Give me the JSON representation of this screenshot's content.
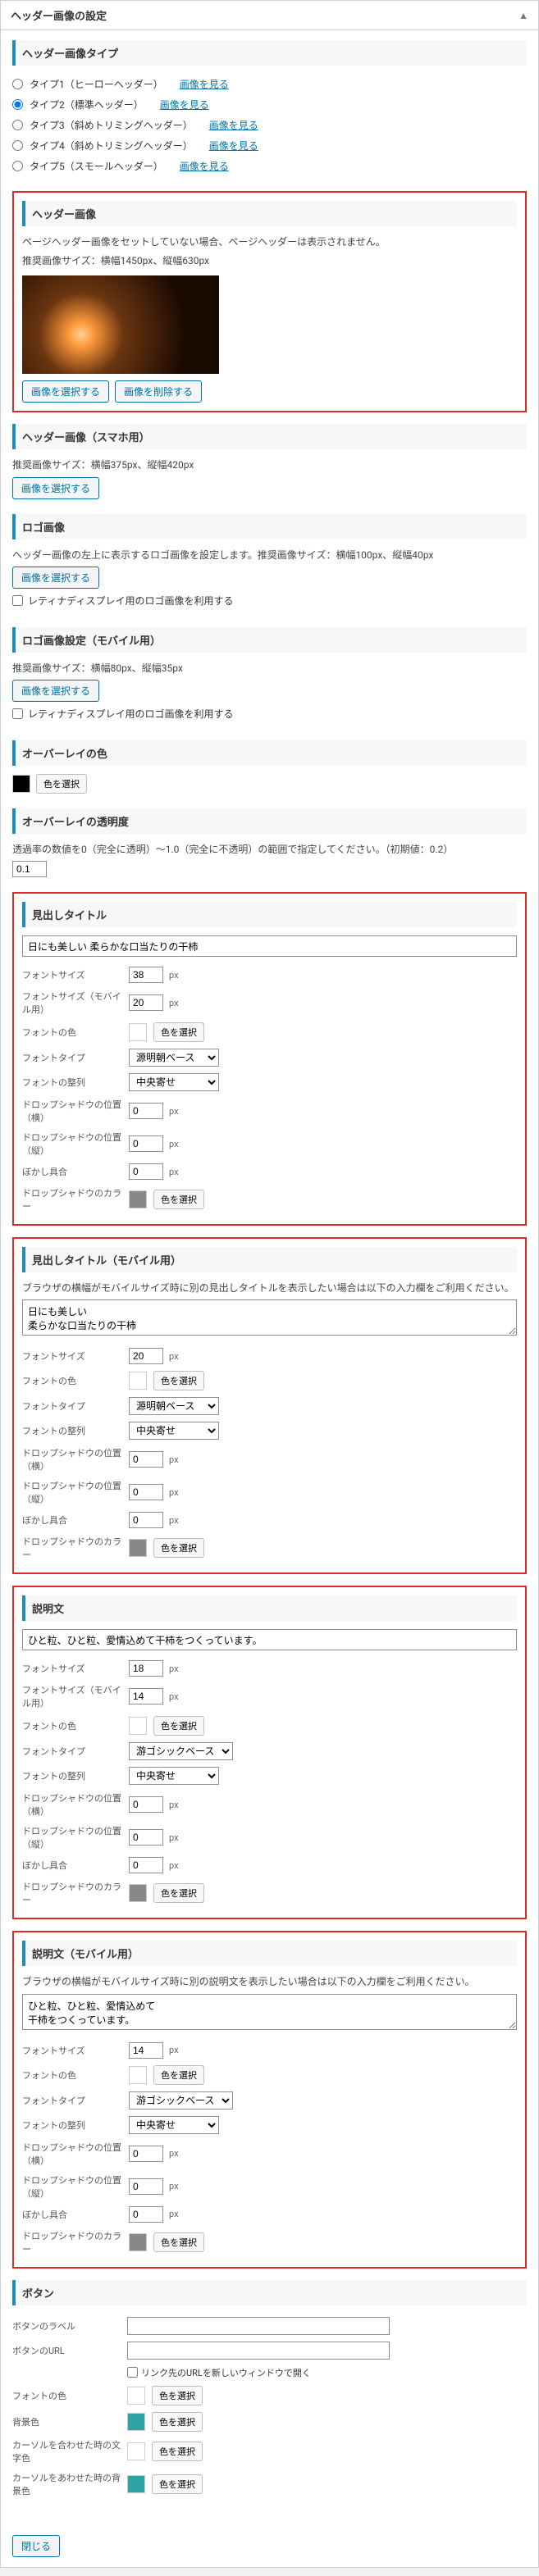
{
  "panel": {
    "title": "ヘッダー画像の設定",
    "toggle": "▲"
  },
  "headerType": {
    "heading": "ヘッダー画像タイプ",
    "view": "画像を見る",
    "opts": [
      "タイプ1（ヒーローヘッダー）",
      "タイプ2（標準ヘッダー）",
      "タイプ3（斜めトリミングヘッダー）",
      "タイプ4（斜めトリミングヘッダー）",
      "タイプ5（スモールヘッダー）"
    ]
  },
  "headerImage": {
    "heading": "ヘッダー画像",
    "note1": "ページヘッダー画像をセットしていない場合、ページヘッダーは表示されません。",
    "note2": "推奨画像サイズ：横幅1450px、縦幅630px",
    "select": "画像を選択する",
    "remove": "画像を削除する"
  },
  "headerImageSp": {
    "heading": "ヘッダー画像（スマホ用）",
    "note": "推奨画像サイズ：横幅375px、縦幅420px",
    "select": "画像を選択する"
  },
  "logo": {
    "heading": "ロゴ画像",
    "note": "ヘッダー画像の左上に表示するロゴ画像を設定します。推奨画像サイズ：横幅100px、縦幅40px",
    "select": "画像を選択する",
    "retina": "レティナディスプレイ用のロゴ画像を利用する"
  },
  "logoSp": {
    "heading": "ロゴ画像設定（モバイル用）",
    "note": "推奨画像サイズ：横幅80px、縦幅35px",
    "select": "画像を選択する",
    "retina": "レティナディスプレイ用のロゴ画像を利用する"
  },
  "overlayColor": {
    "heading": "オーバーレイの色",
    "btn": "色を選択"
  },
  "overlayOpacity": {
    "heading": "オーバーレイの透明度",
    "note": "透過率の数値を0（完全に透明）〜1.0（完全に不透明）の範囲で指定してください。（初期値：0.2）",
    "value": "0.1"
  },
  "titlePc": {
    "heading": "見出しタイトル",
    "text": "日にも美しい 柔らかな口当たりの干柿",
    "fontSize": "38",
    "fontSizeSp": "20",
    "labels": {
      "fontSize": "フォントサイズ",
      "fontSizeSp": "フォントサイズ（モバイル用）",
      "fontColor": "フォントの色",
      "fontType": "フォントタイプ",
      "fontAlign": "フォントの整列",
      "shadowH": "ドロップシャドウの位置（横）",
      "shadowV": "ドロップシャドウの位置（縦）",
      "blur": "ぼかし具合",
      "shadowColor": "ドロップシャドウのカラー"
    },
    "fontType": "源明朝ベース",
    "align": "中央寄せ",
    "shadowH": "0",
    "shadowV": "0",
    "blur": "0",
    "colorBtn": "色を選択"
  },
  "titleSp": {
    "heading": "見出しタイトル（モバイル用）",
    "note": "ブラウザの横幅がモバイルサイズ時に別の見出しタイトルを表示したい場合は以下の入力欄をご利用ください。",
    "text": "日にも美しい\n柔らかな口当たりの干柿",
    "fontSize": "20",
    "fontType": "源明朝ベース",
    "align": "中央寄せ",
    "shadowH": "0",
    "shadowV": "0",
    "blur": "0"
  },
  "descPc": {
    "heading": "説明文",
    "text": "ひと粒、ひと粒、愛情込めて干柿をつくっています。",
    "fontSize": "18",
    "fontSizeSp": "14",
    "fontType": "游ゴシックベース",
    "align": "中央寄せ",
    "shadowH": "0",
    "shadowV": "0",
    "blur": "0"
  },
  "descSp": {
    "heading": "説明文（モバイル用）",
    "note": "ブラウザの横幅がモバイルサイズ時に別の説明文を表示したい場合は以下の入力欄をご利用ください。",
    "text": "ひと粒、ひと粒、愛情込めて\n干柿をつくっています。",
    "fontSize": "14",
    "fontType": "游ゴシックベース",
    "align": "中央寄せ",
    "shadowH": "0",
    "shadowV": "0",
    "blur": "0"
  },
  "button": {
    "heading": "ボタン",
    "labels": {
      "label": "ボタンのラベル",
      "url": "ボタンのURL",
      "newwin": "リンク先のURLを新しいウィンドウで開く",
      "fontColor": "フォントの色",
      "bg": "背景色",
      "cursorText": "カーソルを合わせた時の文字色",
      "cursorBg": "カーソルをあわせた時の背景色"
    },
    "colorBtn": "色を選択"
  },
  "close": "閉じる"
}
